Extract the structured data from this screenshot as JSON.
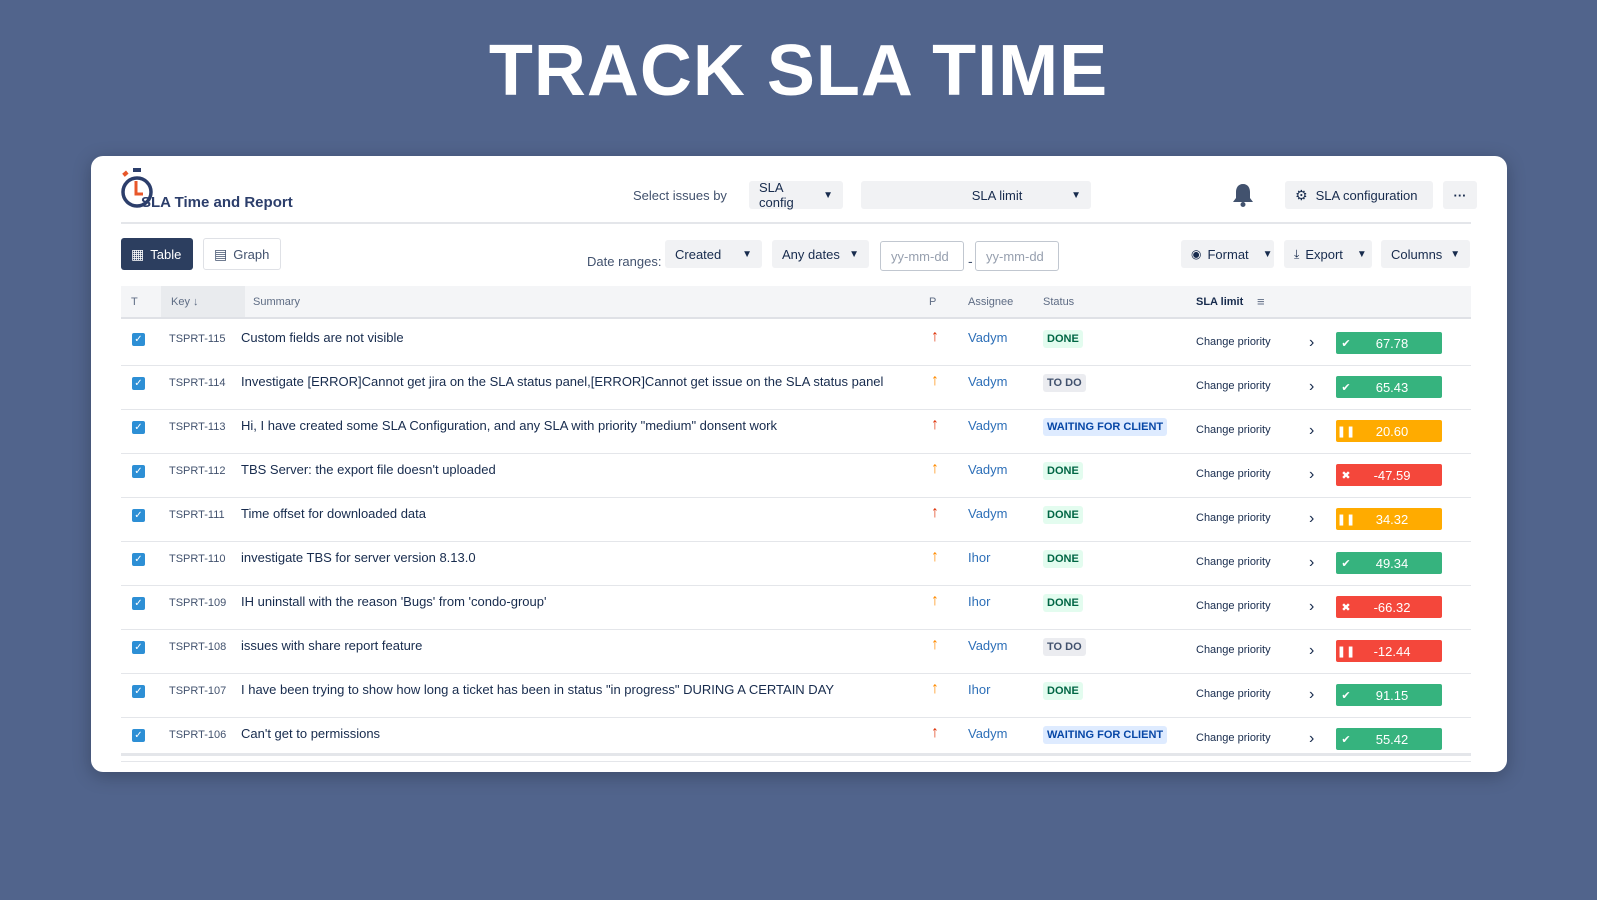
{
  "headline": "TRACK SLA TIME",
  "app": {
    "logo_text": "SLA Time and Report",
    "select_issues_label": "Select issues by",
    "sla_config_dropdown": "SLA config",
    "sla_limit_dropdown": "SLA limit",
    "sla_configuration_button": "SLA configuration",
    "more_button": "···"
  },
  "toolbar": {
    "table_label": "Table",
    "graph_label": "Graph",
    "date_ranges_label": "Date ranges:",
    "created_dropdown": "Created",
    "any_dates_dropdown": "Any dates",
    "date_from_placeholder": "yy-mm-dd",
    "date_to_placeholder": "yy-mm-dd",
    "format_label": "Format",
    "export_label": "Export",
    "columns_label": "Columns"
  },
  "table": {
    "headers": {
      "t": "T",
      "key": "Key",
      "summary": "Summary",
      "p": "P",
      "assignee": "Assignee",
      "status": "Status",
      "sla_limit": "SLA limit"
    },
    "rows": [
      {
        "key": "TSPRT-115",
        "summary": "Custom fields are not visible",
        "priority": "high",
        "assignee": "Vadym",
        "status": "DONE",
        "status_type": "done",
        "action": "Change priority",
        "sla_value": "67.78",
        "sla_state": "ok"
      },
      {
        "key": "TSPRT-114",
        "summary": "Investigate [ERROR]Cannot get jira on the SLA status panel,[ERROR]Cannot get issue on the SLA status panel",
        "priority": "medium",
        "assignee": "Vadym",
        "status": "TO DO",
        "status_type": "todo",
        "action": "Change priority",
        "sla_value": "65.43",
        "sla_state": "ok"
      },
      {
        "key": "TSPRT-113",
        "summary": "Hi, I have created some SLA Configuration, and any SLA with priority \"medium\" donsent work",
        "priority": "high",
        "assignee": "Vadym",
        "status": "WAITING FOR CLIENT",
        "status_type": "wait",
        "action": "Change priority",
        "sla_value": "20.60",
        "sla_state": "paused"
      },
      {
        "key": "TSPRT-112",
        "summary": "TBS Server: the export file doesn't uploaded",
        "priority": "medium",
        "assignee": "Vadym",
        "status": "DONE",
        "status_type": "done",
        "action": "Change priority",
        "sla_value": "-47.59",
        "sla_state": "failed"
      },
      {
        "key": "TSPRT-111",
        "summary": "Time offset for downloaded data",
        "priority": "high",
        "assignee": "Vadym",
        "status": "DONE",
        "status_type": "done",
        "action": "Change priority",
        "sla_value": "34.32",
        "sla_state": "paused"
      },
      {
        "key": "TSPRT-110",
        "summary": "investigate TBS for server version 8.13.0",
        "priority": "medium",
        "assignee": "Ihor",
        "status": "DONE",
        "status_type": "done",
        "action": "Change priority",
        "sla_value": "49.34",
        "sla_state": "ok"
      },
      {
        "key": "TSPRT-109",
        "summary": "IH uninstall with the reason 'Bugs' from 'condo-group'",
        "priority": "medium",
        "assignee": "Ihor",
        "status": "DONE",
        "status_type": "done",
        "action": "Change priority",
        "sla_value": "-66.32",
        "sla_state": "failed"
      },
      {
        "key": "TSPRT-108",
        "summary": "issues with share report feature",
        "priority": "medium",
        "assignee": "Vadym",
        "status": "TO DO",
        "status_type": "todo",
        "action": "Change priority",
        "sla_value": "-12.44",
        "sla_state": "paused-over"
      },
      {
        "key": "TSPRT-107",
        "summary": "I have been trying to show how long a ticket has been in status \"in progress\" DURING A CERTAIN DAY",
        "priority": "medium",
        "assignee": "Ihor",
        "status": "DONE",
        "status_type": "done",
        "action": "Change priority",
        "sla_value": "91.15",
        "sla_state": "ok"
      },
      {
        "key": "TSPRT-106",
        "summary": "Can't get to permissions",
        "priority": "high",
        "assignee": "Vadym",
        "status": "WAITING FOR CLIENT",
        "status_type": "wait",
        "action": "Change priority",
        "sla_value": "55.42",
        "sla_state": "ok"
      }
    ]
  },
  "colors": {
    "background": "#51648c",
    "ok": "#36b37e",
    "paused": "#ffab00",
    "failed": "#f4473b",
    "priority_high": "#de350b",
    "priority_medium": "#ff8b00"
  }
}
